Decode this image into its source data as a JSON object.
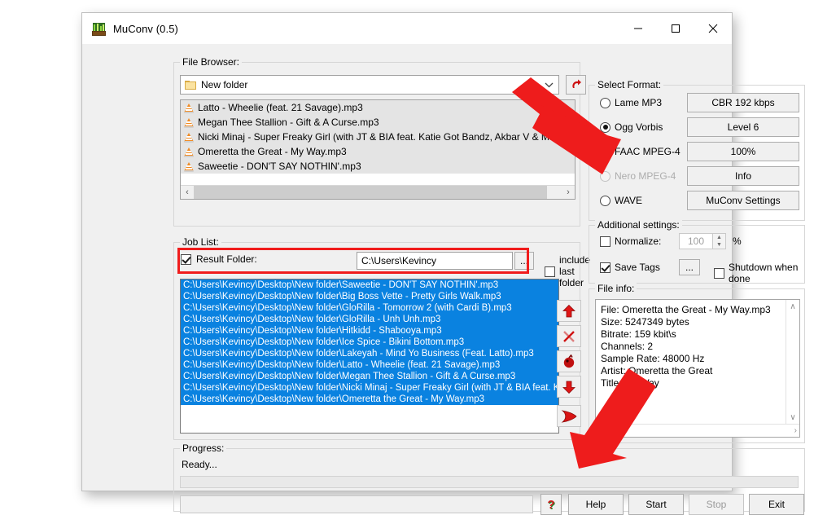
{
  "window": {
    "title": "MuConv (0.5)",
    "icon": "muconv-app-icon",
    "minimize": "minimize-icon",
    "maximize": "maximize-icon",
    "close": "close-icon"
  },
  "file_browser": {
    "legend": "File Browser:",
    "folder_value": "New folder",
    "refresh_title": "refresh",
    "files": [
      "Latto - Wheelie (feat. 21 Savage).mp3",
      "Megan Thee Stallion - Gift & A Curse.mp3",
      "Nicki Minaj - Super Freaky Girl (with JT & BIA feat. Katie Got Bandz, Akbar V & Maliibu Mitch) - Que",
      "Omeretta the Great - My Way.mp3",
      "Saweetie - DON'T SAY NOTHIN'.mp3"
    ],
    "scroll_left": "‹",
    "scroll_right": "›"
  },
  "job_list": {
    "legend": "Job List:",
    "result_folder_label": "Result Folder:",
    "result_folder_checked": true,
    "result_folder_value": "C:\\Users\\Kevincy",
    "browse_label": "...",
    "include_last_folder_label": "include last folder",
    "include_last_folder_checked": false,
    "jobs": [
      "C:\\Users\\Kevincy\\Desktop\\New folder\\Saweetie - DON'T SAY NOTHIN'.mp3",
      "C:\\Users\\Kevincy\\Desktop\\New folder\\Big Boss Vette - Pretty Girls Walk.mp3",
      "C:\\Users\\Kevincy\\Desktop\\New folder\\GloRilla - Tomorrow 2 (with Cardi B).mp3",
      "C:\\Users\\Kevincy\\Desktop\\New folder\\GloRilla - Unh Unh.mp3",
      "C:\\Users\\Kevincy\\Desktop\\New folder\\Hitkidd - Shabooya.mp3",
      "C:\\Users\\Kevincy\\Desktop\\New folder\\Ice Spice - Bikini Bottom.mp3",
      "C:\\Users\\Kevincy\\Desktop\\New folder\\Lakeyah - Mind Yo Business (Feat. Latto).mp3",
      "C:\\Users\\Kevincy\\Desktop\\New folder\\Latto - Wheelie (feat. 21 Savage).mp3",
      "C:\\Users\\Kevincy\\Desktop\\New folder\\Megan Thee Stallion - Gift & A Curse.mp3",
      "C:\\Users\\Kevincy\\Desktop\\New folder\\Nicki Minaj - Super Freaky Girl (with JT & BIA feat. Katie G",
      "C:\\Users\\Kevincy\\Desktop\\New folder\\Omeretta the Great - My Way.mp3"
    ]
  },
  "job_tools": [
    {
      "name": "move-up-button",
      "icon": "arrow-up-icon"
    },
    {
      "name": "remove-button",
      "icon": "scissors-x-icon"
    },
    {
      "name": "clear-button",
      "icon": "bomb-icon"
    },
    {
      "name": "move-down-button",
      "icon": "arrow-down-icon"
    },
    {
      "name": "add-to-job-button",
      "icon": "play-right-icon"
    }
  ],
  "select_format": {
    "legend": "Select Format:",
    "options": [
      {
        "label": "Lame MP3",
        "selected": false,
        "disabled": false
      },
      {
        "label": "Ogg Vorbis",
        "selected": true,
        "disabled": false
      },
      {
        "label": "FAAC MPEG-4",
        "selected": false,
        "disabled": false
      },
      {
        "label": "Nero MPEG-4",
        "selected": false,
        "disabled": true
      },
      {
        "label": "WAVE",
        "selected": false,
        "disabled": false
      }
    ],
    "buttons": [
      "CBR  192 kbps",
      "Level 6",
      "100%",
      "Info",
      "MuConv Settings"
    ]
  },
  "additional_settings": {
    "legend": "Additional settings:",
    "normalize_label": "Normalize:",
    "normalize_checked": false,
    "normalize_value": "100",
    "percent": "%",
    "spin_up": "▲",
    "spin_down": "▼",
    "save_tags_label": "Save Tags",
    "save_tags_checked": true,
    "tags_browse_label": "...",
    "shutdown_label": "Shutdown when done",
    "shutdown_checked": false
  },
  "file_info": {
    "legend": "File info:",
    "lines": [
      "File: Omeretta the Great - My Way.mp3",
      "Size: 5247349 bytes",
      "Bitrate: 159 kbit\\s",
      "Channels: 2",
      "Sample Rate: 48000 Hz",
      "Artist: Omeretta the Great",
      "Title: My Way"
    ],
    "scroll_up": "∧",
    "scroll_down": "∨",
    "scroll_left": "‹",
    "scroll_right": "›"
  },
  "progress": {
    "legend": "Progress:",
    "status": "Ready...",
    "bar_percent": 0
  },
  "bottom_bar": {
    "help_icon": "question-mark-icon",
    "help_glyph": "?",
    "buttons": [
      {
        "label": "Help",
        "disabled": false
      },
      {
        "label": "Start",
        "disabled": false
      },
      {
        "label": "Stop",
        "disabled": true
      },
      {
        "label": "Exit",
        "disabled": false
      }
    ]
  },
  "annotations": {
    "arrow_color": "#ee1c1c",
    "highlight_color": "#f01c1c",
    "arrows": [
      "arrow-pointing-to-ogg-vorbis",
      "arrow-pointing-to-start-button"
    ]
  },
  "colors": {
    "selection_blue": "#0a82e0",
    "window_bg": "#f0f0f0",
    "accent_red": "#ee1c1c"
  }
}
